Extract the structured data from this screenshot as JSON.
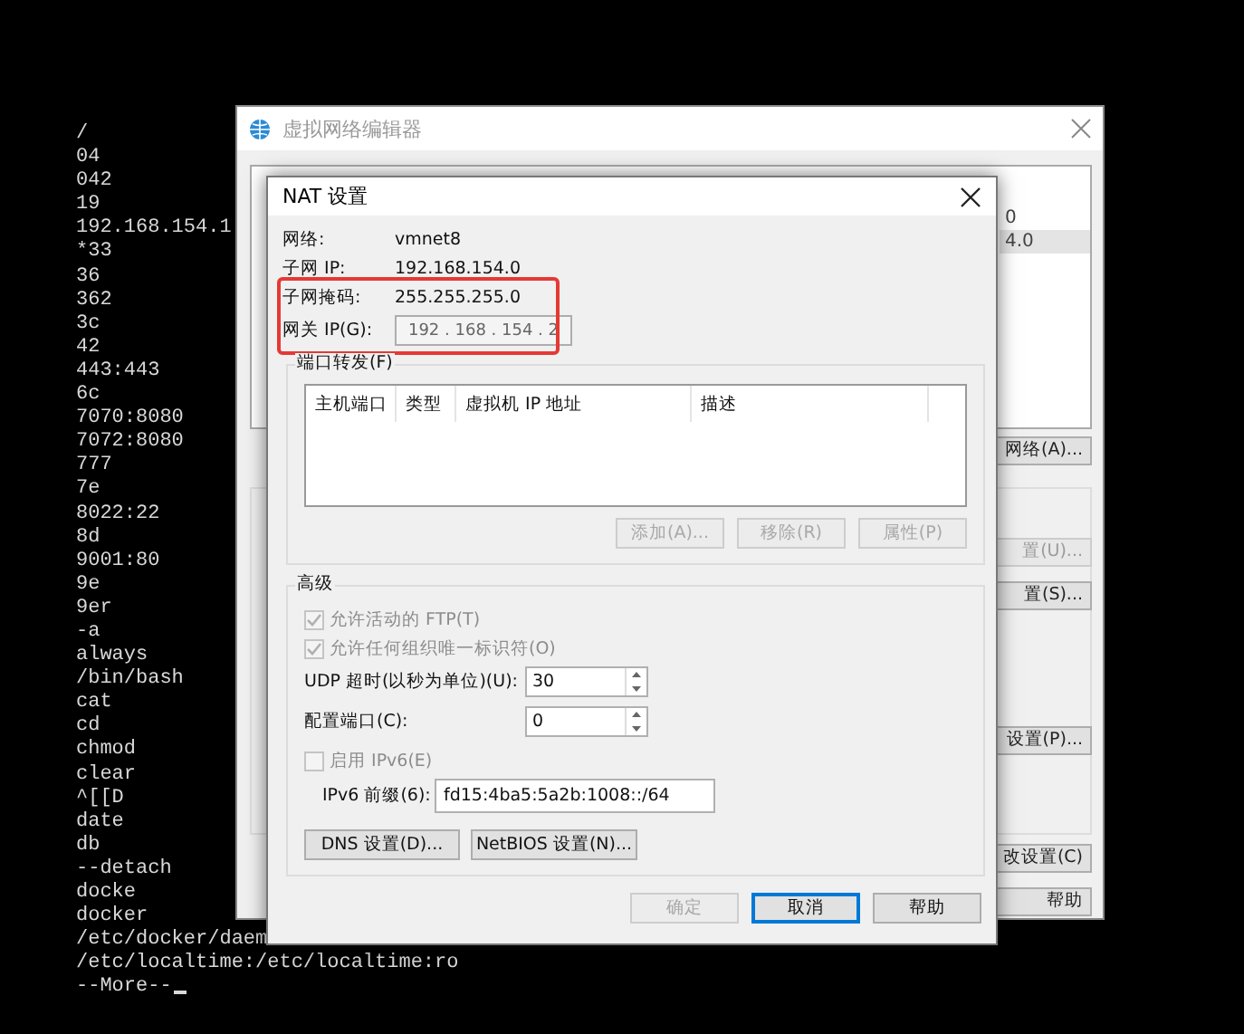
{
  "terminal": {
    "lines": [
      "/",
      "04",
      "042",
      "19",
      "192.168.154.1",
      "*33",
      "36",
      "362",
      "3c",
      "42",
      "443:443",
      "6c",
      "7070:8080",
      "7072:8080",
      "777",
      "7e",
      "8022:22",
      "8d",
      "9001:80",
      "9e",
      "9er",
      "-a",
      "always",
      "/bin/bash",
      "cat",
      "cd",
      "chmod",
      "clear",
      "^[[D",
      "date",
      "db",
      "--detach",
      "docke",
      "docker",
      "/etc/docker/daem",
      "/etc/localtime:/etc/localtime:ro",
      "--More--"
    ],
    "cursor": true
  },
  "background_window": {
    "title": "虚拟网络编辑器",
    "rows": [
      {
        "text": "0",
        "selected": false
      },
      {
        "text": "4.0",
        "selected": true
      }
    ],
    "buttons": [
      {
        "label": "网络(A)...",
        "disabled": false
      },
      {
        "label": "置(U)...",
        "disabled": true
      },
      {
        "label": "置(S)...",
        "disabled": false
      },
      {
        "label": "设置(P)...",
        "disabled": false
      },
      {
        "label": "改设置(C)",
        "disabled": false
      },
      {
        "label": "帮助",
        "disabled": false
      }
    ]
  },
  "dialog": {
    "title": "NAT 设置",
    "info": [
      {
        "label": "网络:",
        "value": "vmnet8"
      },
      {
        "label": "子网 IP:",
        "value": "192.168.154.0"
      },
      {
        "label": "子网掩码:",
        "value": "255.255.255.0"
      }
    ],
    "gateway": {
      "label": "网关 IP(G):",
      "value": "192 . 168 . 154 . 2",
      "disabled": true
    },
    "port_forwarding": {
      "title": "端口转发(F)",
      "columns": [
        "主机端口",
        "类型",
        "虚拟机 IP 地址",
        "描述"
      ],
      "buttons": [
        {
          "label": "添加(A)...",
          "disabled": true
        },
        {
          "label": "移除(R)",
          "disabled": true
        },
        {
          "label": "属性(P)",
          "disabled": true
        }
      ]
    },
    "advanced": {
      "title": "高级",
      "checkboxes": [
        {
          "label": "允许活动的 FTP(T)",
          "checked": true,
          "disabled": true
        },
        {
          "label": "允许任何组织唯一标识符(O)",
          "checked": true,
          "disabled": true
        }
      ],
      "udp_timeout": {
        "label": "UDP 超时(以秒为单位)(U):",
        "value": "30"
      },
      "config_port": {
        "label": "配置端口(C):",
        "value": "0"
      },
      "ipv6": {
        "label": "启用 IPv6(E)",
        "checked": false,
        "disabled": true
      },
      "ipv6_prefix": {
        "label": "IPv6 前缀(6):",
        "value": "fd15:4ba5:5a2b:1008::/64"
      },
      "buttons": [
        {
          "label": "DNS 设置(D)...",
          "disabled": false
        },
        {
          "label": "NetBIOS 设置(N)...",
          "disabled": false
        }
      ]
    },
    "buttons": [
      {
        "label": "确定",
        "disabled": true,
        "focused": false
      },
      {
        "label": "取消",
        "disabled": false,
        "focused": true
      },
      {
        "label": "帮助",
        "disabled": false,
        "focused": false
      }
    ]
  }
}
